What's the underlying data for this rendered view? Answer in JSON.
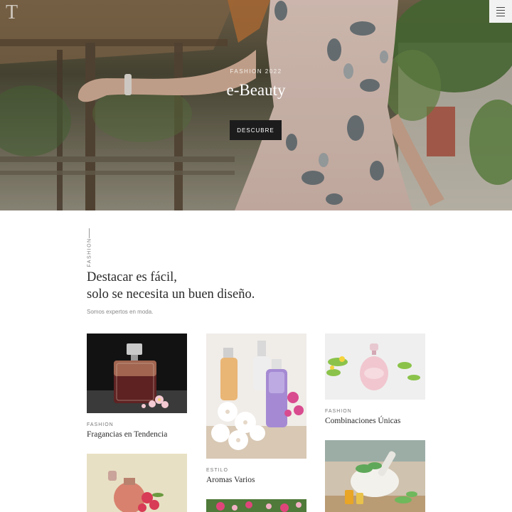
{
  "header": {
    "logo": "T",
    "menu_icon": "hamburger-icon"
  },
  "hero": {
    "kicker": "FASHION 2022",
    "title": "e-Beauty",
    "button_label": "DESCUBRE"
  },
  "intro": {
    "side_label": "FASHION",
    "heading_line1": "Destacar es fácil,",
    "heading_line2": "solo se necesita un buen diseño.",
    "subtitle": "Somos expertos en moda."
  },
  "cards": [
    {
      "category": "FASHION",
      "title": "Fragancias en Tendencia"
    },
    {
      "category": "ESTILO",
      "title": "Aromas Varios"
    },
    {
      "category": "FASHION",
      "title": "Combinaciones Únicas"
    }
  ],
  "colors": {
    "accent_dark": "#1c1c1c",
    "hero_text": "#ffffff",
    "heading_text": "#2a2a2a"
  }
}
